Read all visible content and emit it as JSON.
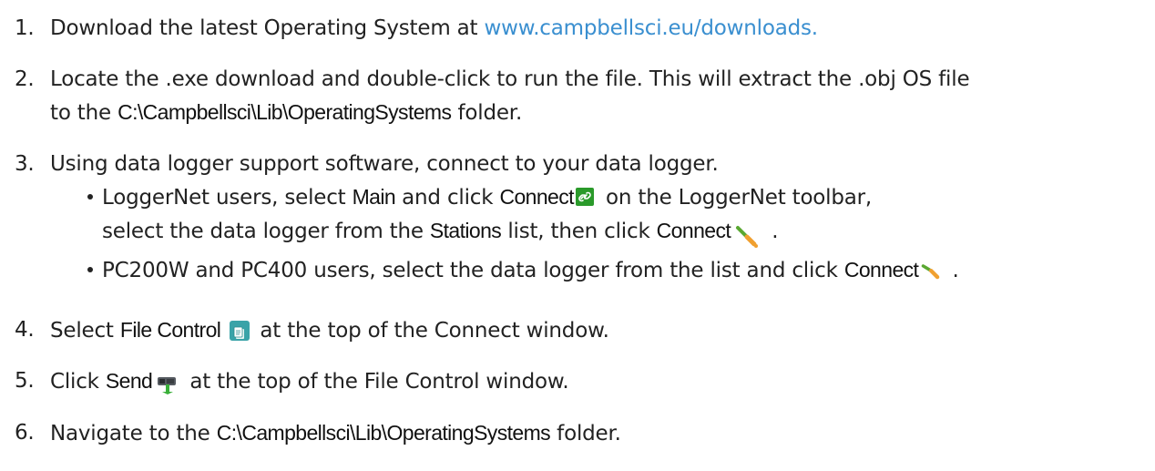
{
  "steps": [
    {
      "num": "1.",
      "text_a": "Download the latest Operating System at ",
      "link": "www.campbellsci.eu/downloads."
    },
    {
      "num": "2.",
      "text_a": "Locate the .exe download and double-click to run the file. This will extract the .obj OS file",
      "text_b": "to the ",
      "path": "C:\\Campbellsci\\Lib\\OperatingSystems",
      "text_c": " folder."
    },
    {
      "num": "3.",
      "text_a": "Using data logger support software, connect to your data logger.",
      "bullets": [
        {
          "a": "LoggerNet users, select ",
          "main": "Main",
          "b": " and click ",
          "connect": "Connect",
          "c": " on the LoggerNet toolbar,",
          "d": "select the data logger from the ",
          "stations": "Stations",
          "e": " list, then click ",
          "connect2": "Connect",
          "f": " ."
        },
        {
          "a": "PC200W and PC400 users, select the data logger from the list and click ",
          "connect": "Connect",
          "b": " ."
        }
      ]
    },
    {
      "num": "4.",
      "a": "Select ",
      "label": "File Control",
      "b": " at the top of the Connect window."
    },
    {
      "num": "5.",
      "a": "Click ",
      "label": "Send",
      "b": " at the top of the File Control window."
    },
    {
      "num": "6.",
      "a": "Navigate to the ",
      "path": "C:\\Campbellsci\\Lib\\OperatingSystems",
      "b": " folder."
    }
  ],
  "icons": {
    "connect_toolbar": "link-icon",
    "connect_plug": "plug-icon",
    "file_control": "file-control-icon",
    "send": "send-icon"
  },
  "colors": {
    "link": "#3a8fd0",
    "text": "#222222",
    "icon_green": "#2a9a2a",
    "icon_teal": "#3aa3a8"
  }
}
